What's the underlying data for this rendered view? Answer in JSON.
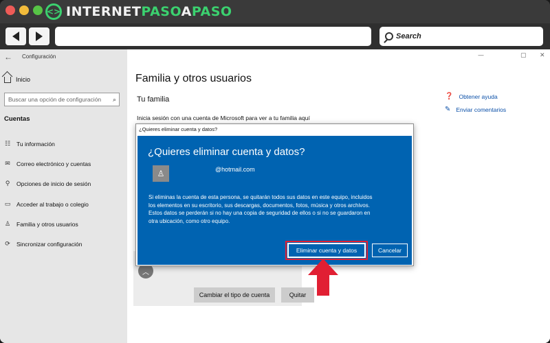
{
  "browser": {
    "logo_part1": "INTERNET",
    "logo_part2": "PASO",
    "logo_part3": "A",
    "logo_part4": "PASO",
    "search_label": "Search",
    "colors": {
      "logo_green": "#3bd16f",
      "chrome_dark": "#3a3a3a"
    }
  },
  "window": {
    "title": "Configuración",
    "back_icon": "arrow-left-icon",
    "controls": {
      "minimize": "—",
      "maximize": "▢",
      "close": "✕"
    }
  },
  "sidebar": {
    "home_label": "Inicio",
    "search_placeholder": "Buscar una opción de configuración",
    "section_title": "Cuentas",
    "items": [
      {
        "label": "Tu información",
        "icon": "person-card-icon"
      },
      {
        "label": "Correo electrónico y cuentas",
        "icon": "mail-icon"
      },
      {
        "label": "Opciones de inicio de sesión",
        "icon": "key-icon"
      },
      {
        "label": "Acceder al trabajo o colegio",
        "icon": "briefcase-icon"
      },
      {
        "label": "Familia y otros usuarios",
        "icon": "person-icon"
      },
      {
        "label": "Sincronizar configuración",
        "icon": "sync-icon"
      }
    ]
  },
  "main": {
    "page_title": "Familia y otros usuarios",
    "subtitle": "Tu familia",
    "intro": "Inicia sesión con una cuenta de Microsoft para ver a tu familia aquí",
    "help_links": [
      {
        "label": "Obtener ayuda",
        "icon": "help-chat-icon"
      },
      {
        "label": "Enviar comentarios",
        "icon": "feedback-icon"
      }
    ],
    "change_type_button": "Cambiar el tipo de cuenta",
    "remove_button": "Quitar"
  },
  "dialog": {
    "window_title": "¿Quieres eliminar cuenta y datos?",
    "heading": "¿Quieres eliminar cuenta y datos?",
    "email": "@hotmail.com",
    "body_lines": [
      "Si eliminas la cuenta de esta persona, se quitarán todos sus datos en este equipo, incluidos",
      "los elementos en su escritorio, sus descargas, documentos, fotos, música y otros archivos.",
      "Estos datos se perderán si no hay una copia de seguridad de ellos o si no se guardaron en",
      "otra ubicación, como otro equipo."
    ],
    "confirm_button": "Eliminar cuenta y datos",
    "cancel_button": "Cancelar",
    "colors": {
      "accent": "#0063b1",
      "highlight": "#e11f33"
    }
  }
}
